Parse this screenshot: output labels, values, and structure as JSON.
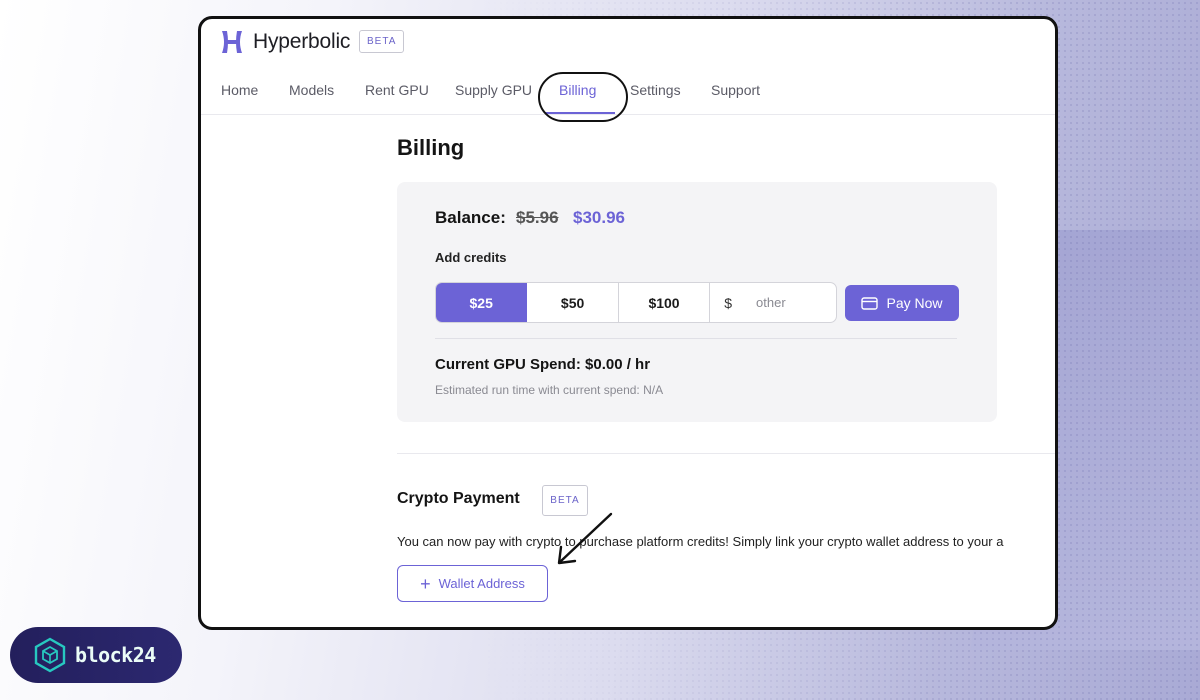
{
  "app": {
    "brand": "Hyperbolic",
    "beta_label": "BETA"
  },
  "nav": {
    "items": [
      {
        "label": "Home"
      },
      {
        "label": "Models"
      },
      {
        "label": "Rent GPU"
      },
      {
        "label": "Supply GPU"
      },
      {
        "label": "Billing",
        "active": true
      },
      {
        "label": "Settings"
      },
      {
        "label": "Support"
      }
    ]
  },
  "billing": {
    "title": "Billing",
    "balance_label": "Balance:",
    "balance_old": "$5.96",
    "balance_new": "$30.96",
    "add_credits_label": "Add credits",
    "amounts": [
      "$25",
      "$50",
      "$100"
    ],
    "selected_amount": "$25",
    "other_prefix": "$",
    "other_placeholder": "other",
    "pay_now_label": "Pay Now",
    "gpu_spend": "Current GPU Spend: $0.00 / hr",
    "estimate": "Estimated run time with current spend: N/A"
  },
  "crypto": {
    "title": "Crypto Payment",
    "beta_label": "BETA",
    "description": "You can now pay with crypto to purchase platform credits! Simply link your crypto wallet address to your a",
    "wallet_button_label": "Wallet Address",
    "plus_glyph": "+"
  },
  "watermark": {
    "text": "block24"
  },
  "colors": {
    "accent": "#6c63d6",
    "badge_bg": "#231f5c",
    "badge_logo": "#27c8c0"
  }
}
